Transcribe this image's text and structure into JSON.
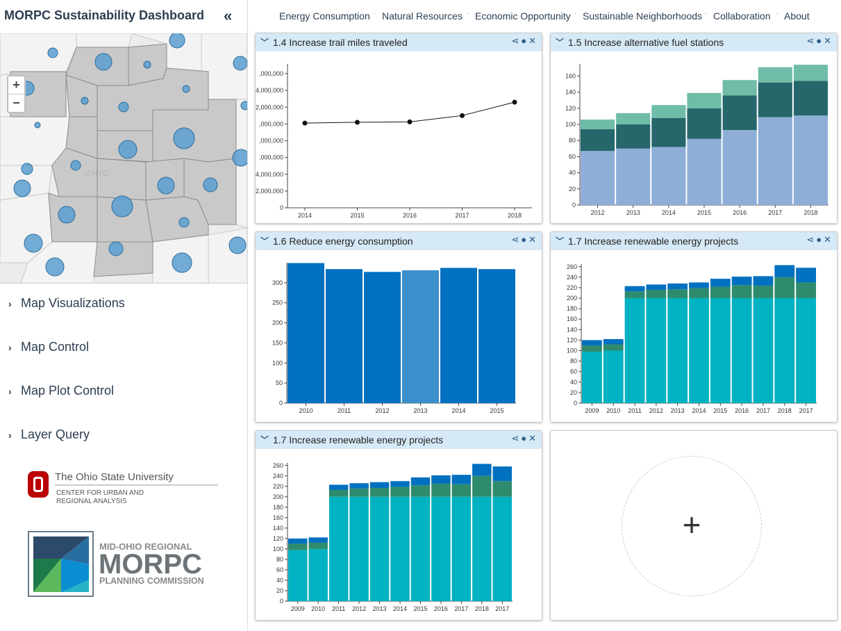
{
  "app": {
    "title": "MORPC Sustainability Dashboard",
    "collapse_icon": "double-chevron-left-icon"
  },
  "nav": {
    "items": [
      "Energy Consumption",
      "Natural Resources",
      "Economic Opportunity",
      "Sustainable Neighborhoods",
      "Collaboration",
      "About"
    ]
  },
  "map": {
    "zoom_in": "+",
    "zoom_out": "−",
    "state_label": "OHIO"
  },
  "sidebar": {
    "sections": [
      {
        "label": "Map Visualizations"
      },
      {
        "label": "Map Control"
      },
      {
        "label": "Map Plot Control"
      },
      {
        "label": "Layer Query"
      }
    ]
  },
  "logos": {
    "osu": {
      "name": "The Ohio State University",
      "line1": "CENTER FOR URBAN AND",
      "line2": "REGIONAL ANALYSIS"
    },
    "morpc": {
      "line1": "MID-OHIO REGIONAL",
      "line2": "MORPC",
      "line3": "PLANNING COMMISSION"
    }
  },
  "add_card": {
    "icon": "+"
  },
  "colors": {
    "header_bg": "#d6e9f6",
    "title_color": "#2c3e50",
    "bar_blue": "#0070c0",
    "bar_highlight": "#3a8fcc",
    "teal": "#00b2c2",
    "green": "#2e8b6e",
    "line": "#111111"
  },
  "cards": [
    {
      "title": "1.4 Increase trail miles traveled"
    },
    {
      "title": "1.5 Increase alternative fuel stations"
    },
    {
      "title": "1.6 Reduce energy consumption"
    },
    {
      "title": "1.7 Increase renewable energy projects"
    },
    {
      "title": "1.7 Increase renewable energy projects"
    }
  ],
  "chart_data": [
    {
      "type": "line",
      "title": "1.4 Increase trail miles traveled",
      "x": [
        "2014",
        "2015",
        "2016",
        "2017",
        "2018"
      ],
      "values": [
        10100000,
        10200000,
        10250000,
        11000000,
        12600000
      ],
      "yticks": [
        ",000,000",
        "4,000,000",
        "2,000,000",
        ",000,000",
        ",000,000",
        ",000,000",
        "4,000,000",
        "2,000,000",
        "0"
      ]
    },
    {
      "type": "bar",
      "title": "1.5 Increase alternative fuel stations",
      "categories": [
        "2012",
        "2013",
        "2014",
        "2015",
        "2016",
        "2017",
        "2018"
      ],
      "series": [
        {
          "color": "#8eaed7",
          "values": [
            67,
            70,
            72,
            82,
            93,
            109,
            111
          ]
        },
        {
          "color": "#26676b",
          "values": [
            27,
            30,
            36,
            38,
            43,
            43,
            43
          ]
        },
        {
          "color": "#6fbca8",
          "values": [
            12,
            14,
            16,
            19,
            19,
            19,
            20
          ]
        }
      ],
      "yticks": [
        0,
        20,
        40,
        60,
        80,
        100,
        120,
        140,
        160
      ],
      "ylim": [
        0,
        175
      ]
    },
    {
      "type": "bar",
      "title": "1.6 Reduce energy consumption",
      "categories": [
        "2010",
        "2011",
        "2012",
        "2013",
        "2014",
        "2015"
      ],
      "values": [
        349,
        334,
        327,
        331,
        337,
        334
      ],
      "highlight_index": 3,
      "yticks": [
        0,
        50,
        100,
        150,
        200,
        250,
        300
      ],
      "ylim": [
        0,
        350
      ]
    },
    {
      "type": "bar",
      "title": "1.7 Increase renewable energy projects",
      "categories": [
        "2009",
        "2010",
        "2011",
        "2012",
        "2013",
        "2014",
        "2015",
        "2016",
        "2017",
        "2018",
        "2017"
      ],
      "series": [
        {
          "color": "#00b2c2",
          "values": [
            98,
            100,
            200,
            200,
            200,
            200,
            200,
            200,
            200,
            200,
            200
          ]
        },
        {
          "color": "#2e8b6e",
          "values": [
            12,
            12,
            13,
            16,
            17,
            19,
            22,
            25,
            24,
            40,
            30
          ]
        },
        {
          "color": "#0070c0",
          "values": [
            10,
            10,
            10,
            10,
            11,
            11,
            15,
            16,
            18,
            23,
            28
          ]
        }
      ],
      "yticks": [
        0,
        20,
        40,
        60,
        80,
        100,
        120,
        140,
        160,
        180,
        200,
        220,
        240,
        260
      ],
      "ylim": [
        0,
        265
      ]
    },
    {
      "type": "bar",
      "title": "1.7 Increase renewable energy projects",
      "categories": [
        "2009",
        "2010",
        "2011",
        "2012",
        "2013",
        "2014",
        "2015",
        "2016",
        "2017",
        "2018",
        "2017"
      ],
      "series": [
        {
          "color": "#00b2c2",
          "values": [
            98,
            100,
            200,
            200,
            200,
            200,
            200,
            200,
            200,
            200,
            200
          ]
        },
        {
          "color": "#2e8b6e",
          "values": [
            12,
            12,
            13,
            16,
            17,
            19,
            22,
            25,
            24,
            40,
            30
          ]
        },
        {
          "color": "#0070c0",
          "values": [
            10,
            10,
            10,
            10,
            11,
            11,
            15,
            16,
            18,
            23,
            28
          ]
        }
      ],
      "yticks": [
        0,
        20,
        40,
        60,
        80,
        100,
        120,
        140,
        160,
        180,
        200,
        220,
        240,
        260
      ],
      "ylim": [
        0,
        265
      ]
    }
  ]
}
